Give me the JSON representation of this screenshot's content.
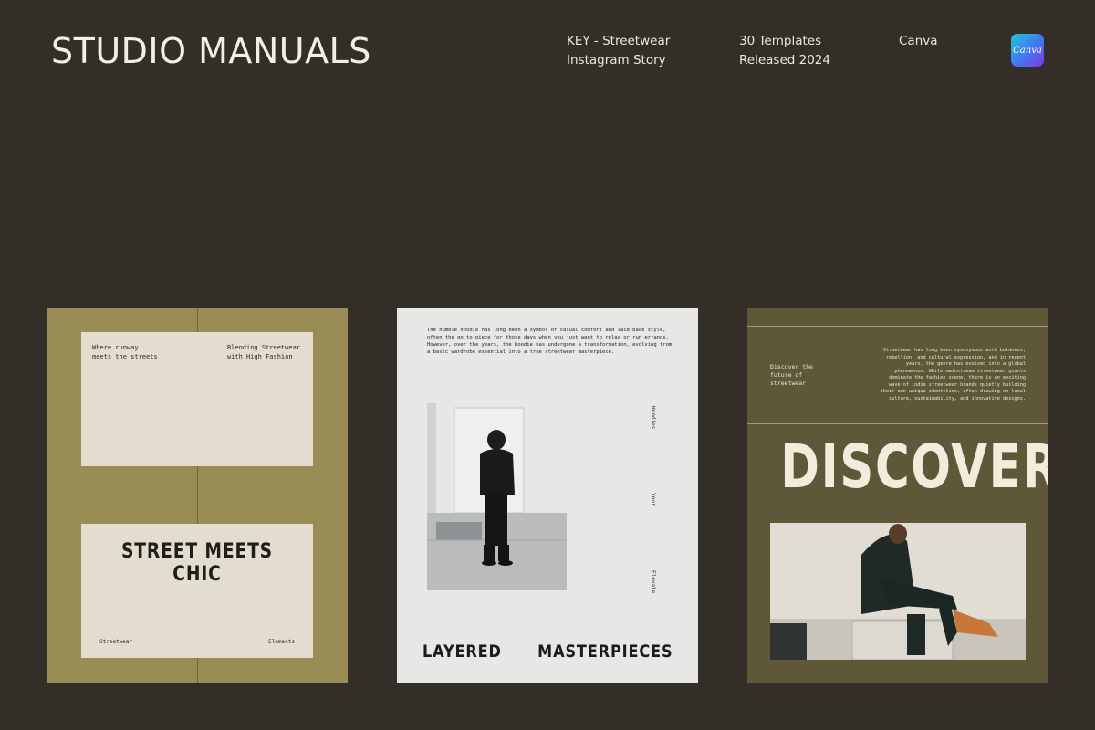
{
  "header": {
    "brand": "STUDIO MANUALS",
    "meta": [
      {
        "line1": "KEY - Streetwear",
        "line2": "Instagram Story"
      },
      {
        "line1": "30 Templates",
        "line2": "Released 2024"
      },
      {
        "line1": "Canva",
        "line2": ""
      }
    ],
    "badge": {
      "label": "Canva",
      "icon": "canva-logo",
      "colors": [
        "#21c9d5",
        "#3f7cf0",
        "#7b3ae8"
      ]
    }
  },
  "colors": {
    "background": "#332e28",
    "card1_bg": "#998d55",
    "card2_bg": "#e7e7e5",
    "card3_bg": "#5e5738",
    "panel": "#e2ddcf"
  },
  "cards": [
    {
      "top_left": "Where runway\nmeets the streets",
      "top_right": "Blending Streetwear\nwith High Fashion",
      "headline": "STREET MEETS CHIC",
      "bottom_left": "Streetwear",
      "bottom_right": "Elements"
    },
    {
      "paragraph": "The humble hoodie has long been a symbol of casual comfort and laid-back style, often the go to piece for those days when you just want to relax or run errands. However, over the years, the hoodie has undergone a transformation, evolving from a basic wardrobe essential into a true streetwear masterpiece.",
      "vertical_words": [
        "Hoodies",
        "Your",
        "Elevate"
      ],
      "big_left": "LAYERED",
      "big_right": "MASTERPIECES"
    },
    {
      "side_text": "Discover the\nfuture of\nstreetwear",
      "paragraph": "Streetwear has long been synonymous with boldness, rebellion, and cultural expression, and in recent years, the genre has evolved into a global phenomenon. While mainstream streetwear giants dominate the fashion scene, there is an exciting wave of indie streetwear brands quietly building their own unique identities, often drawing on local culture, sustainability, and innovative designs.",
      "headline": "DISCOVER"
    }
  ]
}
